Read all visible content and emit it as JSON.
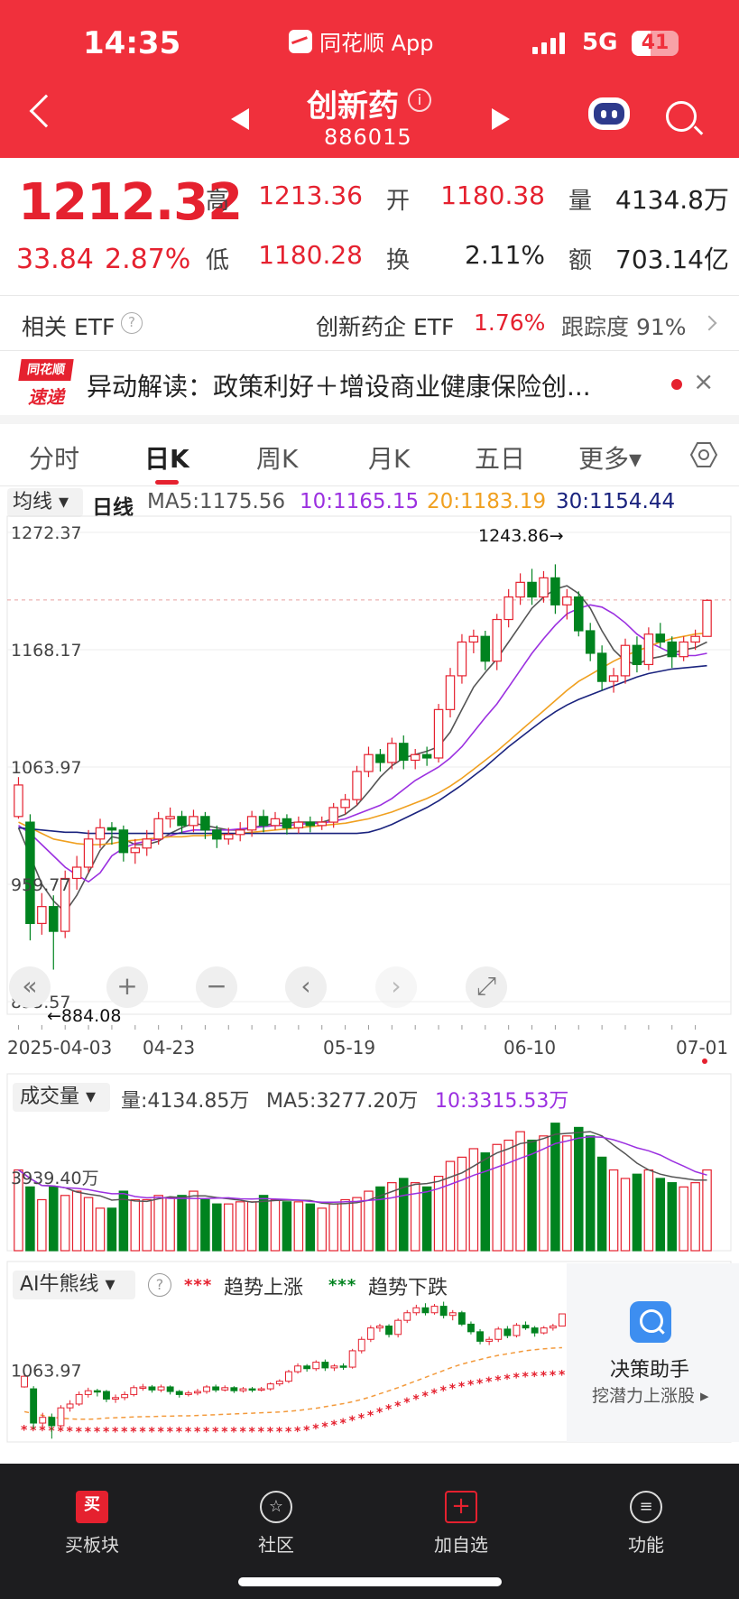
{
  "status": {
    "time": "14:35",
    "network": "5G",
    "battery": "41",
    "battery_level": 0.41
  },
  "header": {
    "app_title": "同花顺 App",
    "stock_name": "创新药",
    "stock_code": "886015",
    "info_icon": "i"
  },
  "quote": {
    "price": "1212.32",
    "change": "33.84",
    "change_pct": "2.87%",
    "high_label": "高",
    "high": "1213.36",
    "low_label": "低",
    "low": "1180.28",
    "open_label": "开",
    "open": "1180.38",
    "turnover_label": "换",
    "turnover": "2.11%",
    "volume_label": "量",
    "volume": "4134.8万",
    "amount_label": "额",
    "amount": "703.14亿"
  },
  "etf": {
    "label": "相关 ETF",
    "help": "?",
    "name": "创新药企 ETF",
    "pct": "1.76%",
    "track": "跟踪度 91%"
  },
  "news": {
    "logo_top": "同花顺",
    "logo_bottom": "速递",
    "text": "异动解读：政策利好＋增设商业健康保险创...",
    "close": "×"
  },
  "tabs": [
    {
      "label": "分时"
    },
    {
      "label": "日K"
    },
    {
      "label": "周K"
    },
    {
      "label": "月K"
    },
    {
      "label": "五日"
    },
    {
      "label": "更多▾"
    }
  ],
  "ma_bar": {
    "select": "均线 ▾",
    "kind": "日线",
    "ma5": "MA5:1175.56",
    "ma10": "10:1165.15",
    "ma20": "20:1183.19",
    "ma30": "30:1154.44"
  },
  "controls": {
    "rewind": "«",
    "zoom_in": "+",
    "zoom_out": "−",
    "prev": "‹",
    "next": "›",
    "fullscreen": "⤢"
  },
  "vol_bar": {
    "select": "成交量 ▾",
    "vol": "量:4134.85万",
    "ma5": "MA5:3277.20万",
    "ma10": "10:3315.53万"
  },
  "ai_bar": {
    "select": "AI牛熊线 ▾",
    "help": "?",
    "stars": "***",
    "up": "趋势上涨",
    "down": "趋势下跌"
  },
  "assistant": {
    "title": "决策助手",
    "subtitle": "挖潜力上涨股 ▸"
  },
  "bottom_nav": [
    {
      "icon": "买",
      "label": "买板块"
    },
    {
      "icon": "☆",
      "label": "社区"
    },
    {
      "icon": "+",
      "label": "加自选"
    },
    {
      "icon": "≡",
      "label": "功能"
    }
  ],
  "colors": {
    "up": "#e5212f",
    "down": "#00831f",
    "ma5": "#555555",
    "ma10": "#9b30e0",
    "ma20": "#f0a020",
    "ma30": "#1a237e",
    "header": "#f0303c"
  },
  "chart_data": {
    "type": "candlestick",
    "ylim": [
      855.57,
      1272.37
    ],
    "y_ticks": [
      "1272.37",
      "1168.17",
      "1063.97",
      "959.77",
      "855.57"
    ],
    "x_ticks": [
      "2025-04-03",
      "04-23",
      "05-19",
      "06-10",
      "07-01"
    ],
    "max_label": "1243.86→",
    "min_label": "←884.08",
    "max_value": 1243.86,
    "min_value": 884.08,
    "candles": [
      [
        1020,
        1048,
        1055,
        1018
      ],
      [
        1015,
        925,
        1022,
        910
      ],
      [
        925,
        940,
        952,
        915
      ],
      [
        940,
        918,
        950,
        884
      ],
      [
        918,
        965,
        972,
        912
      ],
      [
        965,
        975,
        985,
        955
      ],
      [
        975,
        1000,
        1008,
        970
      ],
      [
        1000,
        1010,
        1018,
        992
      ],
      [
        1010,
        1008,
        1015,
        995
      ],
      [
        1008,
        988,
        1012,
        980
      ],
      [
        988,
        992,
        1000,
        978
      ],
      [
        992,
        1000,
        1008,
        985
      ],
      [
        1000,
        1018,
        1024,
        995
      ],
      [
        1018,
        1020,
        1028,
        1010
      ],
      [
        1020,
        1012,
        1025,
        1005
      ],
      [
        1012,
        1020,
        1026,
        1006
      ],
      [
        1020,
        1008,
        1024,
        1000
      ],
      [
        1008,
        1000,
        1012,
        992
      ],
      [
        1000,
        1004,
        1010,
        995
      ],
      [
        1004,
        1008,
        1015,
        998
      ],
      [
        1008,
        1020,
        1025,
        1002
      ],
      [
        1020,
        1012,
        1026,
        1006
      ],
      [
        1012,
        1018,
        1024,
        1008
      ],
      [
        1018,
        1010,
        1022,
        1004
      ],
      [
        1010,
        1015,
        1020,
        1005
      ],
      [
        1015,
        1012,
        1020,
        1006
      ],
      [
        1012,
        1015,
        1020,
        1008
      ],
      [
        1015,
        1028,
        1032,
        1010
      ],
      [
        1028,
        1035,
        1040,
        1022
      ],
      [
        1035,
        1060,
        1065,
        1030
      ],
      [
        1060,
        1075,
        1082,
        1055
      ],
      [
        1075,
        1068,
        1080,
        1060
      ],
      [
        1068,
        1085,
        1090,
        1062
      ],
      [
        1085,
        1070,
        1092,
        1062
      ],
      [
        1070,
        1075,
        1080,
        1062
      ],
      [
        1075,
        1072,
        1082,
        1065
      ],
      [
        1072,
        1115,
        1120,
        1068
      ],
      [
        1115,
        1145,
        1152,
        1108
      ],
      [
        1145,
        1175,
        1182,
        1138
      ],
      [
        1175,
        1180,
        1186,
        1165
      ],
      [
        1180,
        1158,
        1185,
        1150
      ],
      [
        1158,
        1195,
        1200,
        1150
      ],
      [
        1195,
        1215,
        1222,
        1188
      ],
      [
        1215,
        1228,
        1236,
        1208
      ],
      [
        1228,
        1215,
        1240,
        1208
      ],
      [
        1215,
        1232,
        1238,
        1210
      ],
      [
        1232,
        1208,
        1244,
        1200
      ],
      [
        1208,
        1215,
        1222,
        1195
      ],
      [
        1215,
        1185,
        1220,
        1180
      ],
      [
        1185,
        1165,
        1192,
        1158
      ],
      [
        1165,
        1140,
        1172,
        1132
      ],
      [
        1140,
        1145,
        1152,
        1130
      ],
      [
        1145,
        1172,
        1178,
        1138
      ],
      [
        1172,
        1155,
        1180,
        1148
      ],
      [
        1155,
        1182,
        1188,
        1150
      ],
      [
        1182,
        1175,
        1192,
        1170
      ],
      [
        1175,
        1162,
        1180,
        1152
      ],
      [
        1162,
        1175,
        1180,
        1158
      ],
      [
        1175,
        1180,
        1186,
        1168
      ],
      [
        1180,
        1212,
        1213,
        1180
      ]
    ],
    "series": [
      {
        "name": "MA5",
        "values": [
          1010,
          985,
          960,
          945,
          935,
          950,
          970,
          990,
          1002,
          1000,
          995,
          995,
          998,
          1005,
          1010,
          1014,
          1012,
          1010,
          1008,
          1008,
          1010,
          1012,
          1014,
          1014,
          1015,
          1015,
          1015,
          1018,
          1022,
          1030,
          1042,
          1055,
          1065,
          1072,
          1075,
          1078,
          1082,
          1095,
          1115,
          1135,
          1148,
          1160,
          1175,
          1190,
          1205,
          1215,
          1222,
          1225,
          1218,
          1205,
          1185,
          1168,
          1158,
          1155,
          1160,
          1162,
          1165,
          1168,
          1170,
          1175
        ]
      },
      {
        "name": "MA10",
        "values": [
          1012,
          1005,
          995,
          985,
          975,
          968,
          962,
          970,
          985,
          992,
          996,
          998,
          1000,
          1003,
          1006,
          1008,
          1008,
          1008,
          1008,
          1009,
          1010,
          1011,
          1012,
          1012,
          1013,
          1014,
          1014,
          1016,
          1018,
          1022,
          1026,
          1030,
          1036,
          1044,
          1052,
          1058,
          1064,
          1072,
          1082,
          1095,
          1108,
          1120,
          1135,
          1150,
          1165,
          1178,
          1190,
          1200,
          1205,
          1208,
          1206,
          1200,
          1192,
          1182,
          1175,
          1170,
          1165,
          1163,
          1163,
          1165
        ]
      },
      {
        "name": "MA20",
        "values": [
          1015,
          1010,
          1005,
          1000,
          998,
          996,
          995,
          995,
          996,
          998,
          999,
          1000,
          1001,
          1002,
          1002,
          1003,
          1003,
          1004,
          1004,
          1005,
          1006,
          1007,
          1008,
          1009,
          1010,
          1011,
          1012,
          1013,
          1014,
          1016,
          1018,
          1021,
          1024,
          1028,
          1032,
          1036,
          1041,
          1047,
          1054,
          1062,
          1070,
          1078,
          1087,
          1096,
          1105,
          1114,
          1123,
          1132,
          1140,
          1146,
          1152,
          1158,
          1163,
          1167,
          1171,
          1175,
          1178,
          1180,
          1182,
          1183
        ]
      },
      {
        "name": "MA30",
        "values": [
          1010,
          1009,
          1008,
          1007,
          1006,
          1006,
          1005,
          1005,
          1005,
          1005,
          1005,
          1005,
          1005,
          1005,
          1005,
          1005,
          1005,
          1005,
          1005,
          1005,
          1005,
          1005,
          1005,
          1005,
          1005,
          1005,
          1005,
          1005,
          1005,
          1005,
          1006,
          1009,
          1013,
          1018,
          1023,
          1028,
          1034,
          1041,
          1048,
          1056,
          1064,
          1073,
          1082,
          1090,
          1098,
          1106,
          1113,
          1119,
          1124,
          1128,
          1132,
          1136,
          1140,
          1144,
          1147,
          1149,
          1151,
          1152,
          1153,
          1154
        ]
      }
    ],
    "volume": {
      "ylabel": "3939.40万",
      "values": [
        38,
        30,
        24,
        30,
        26,
        28,
        25,
        20,
        20,
        28,
        24,
        24,
        26,
        25,
        26,
        28,
        24,
        22,
        22,
        23,
        23,
        26,
        24,
        23,
        23,
        22,
        20,
        22,
        24,
        25,
        28,
        30,
        32,
        34,
        32,
        30,
        35,
        42,
        44,
        48,
        46,
        50,
        52,
        56,
        52,
        54,
        60,
        54,
        58,
        54,
        44,
        38,
        34,
        36,
        38,
        34,
        32,
        30,
        32,
        38
      ]
    }
  }
}
